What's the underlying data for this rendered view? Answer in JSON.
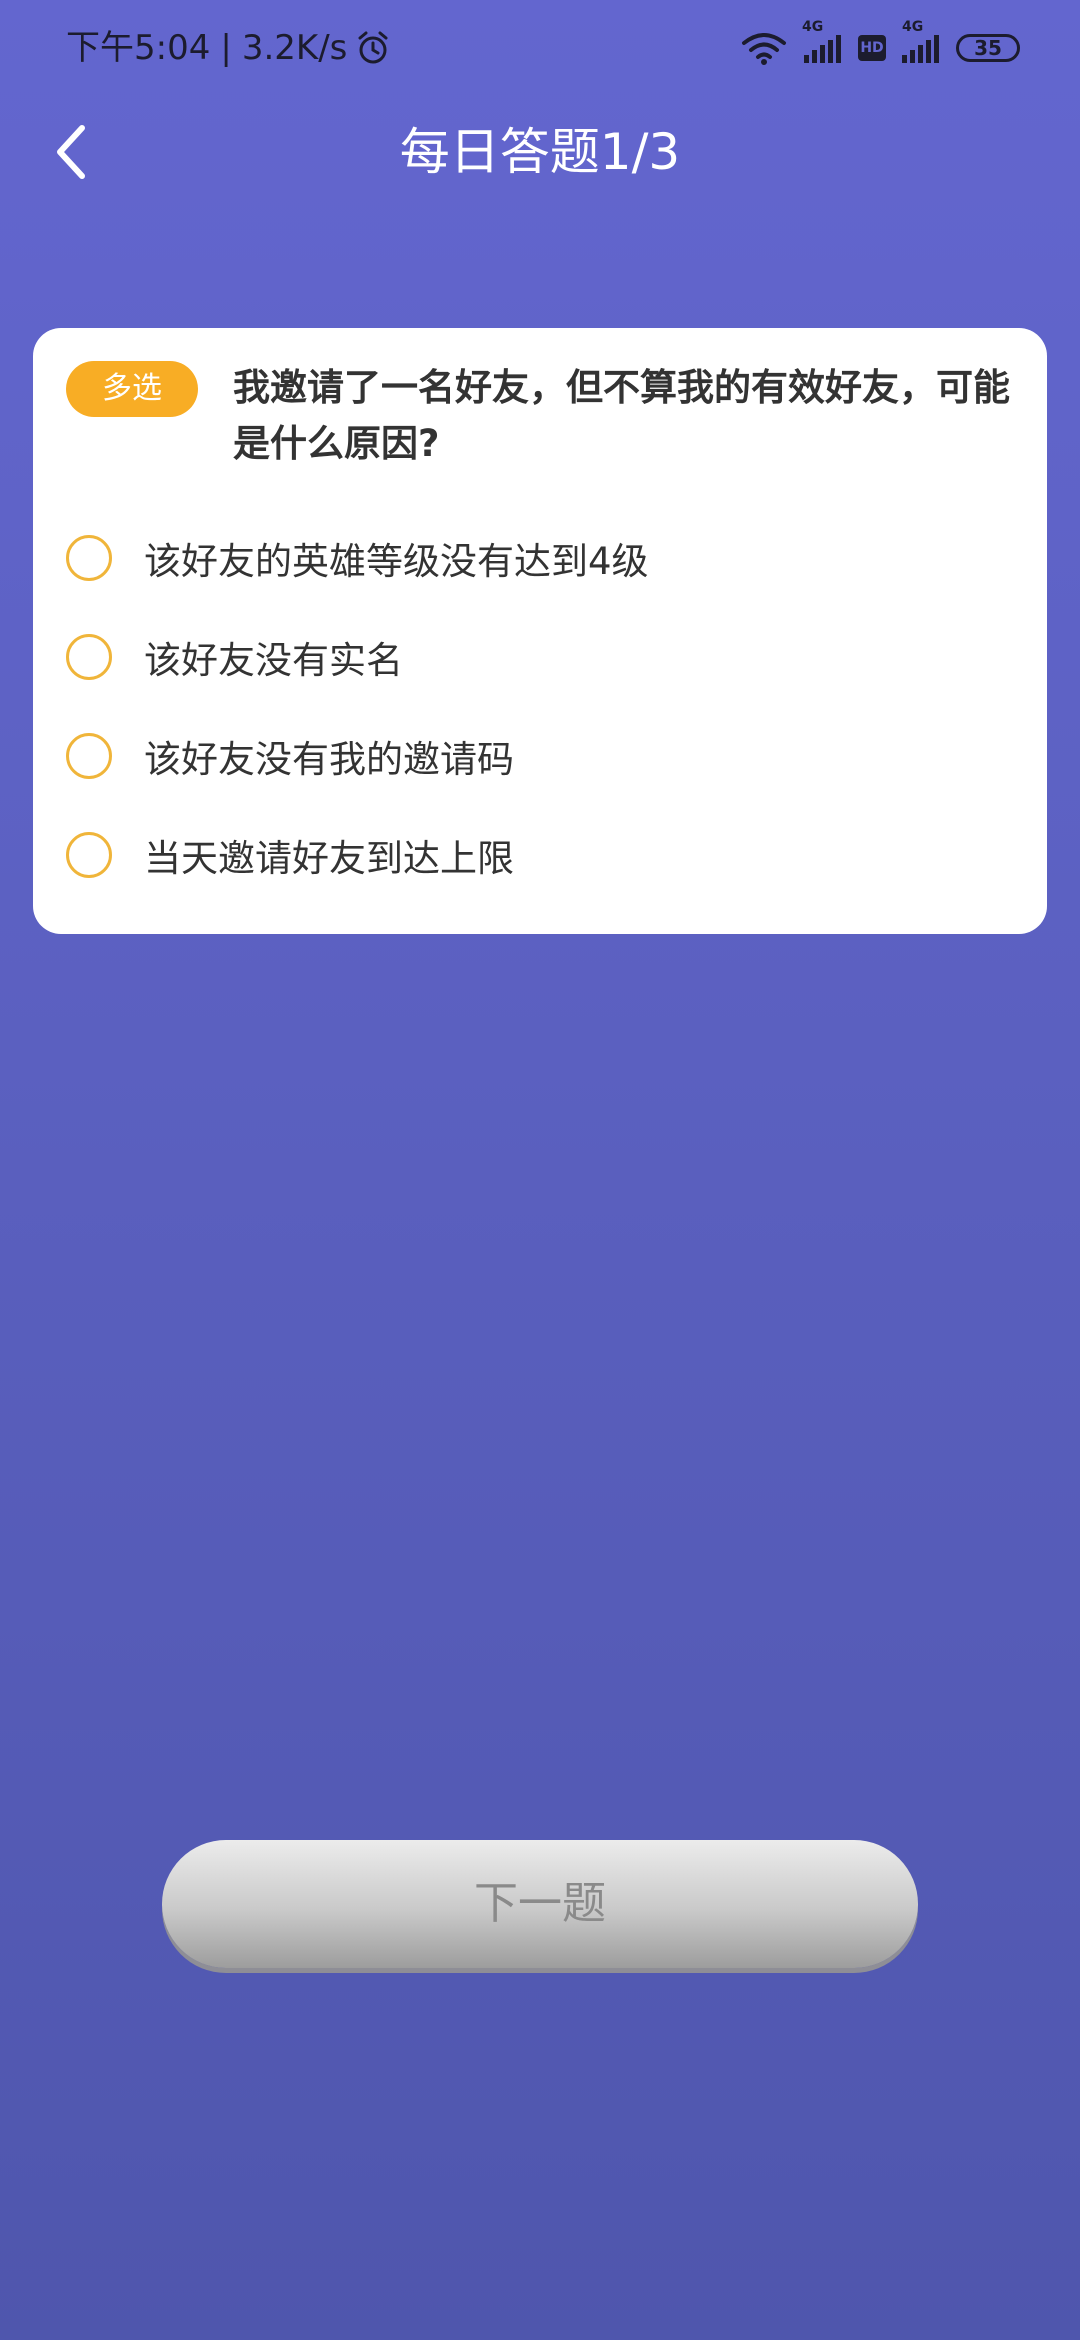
{
  "status_bar": {
    "time": "下午5:04",
    "separator": "|",
    "speed": "3.2K/s",
    "sim1_label": "4G",
    "hd_label": "HD",
    "sim2_label": "4G",
    "battery": "35"
  },
  "header": {
    "title": "每日答题1/3"
  },
  "question": {
    "type_badge": "多选",
    "text": "我邀请了一名好友，但不算我的有效好友，可能是什么原因?",
    "options": [
      {
        "label": "该好友的英雄等级没有达到4级"
      },
      {
        "label": "该好友没有实名"
      },
      {
        "label": "该好友没有我的邀请码"
      },
      {
        "label": "当天邀请好友到达上限"
      }
    ]
  },
  "footer": {
    "next_label": "下一题"
  },
  "colors": {
    "accent": "#f8ad25",
    "radio_border": "#f0b53a",
    "background_top": "#6366cf",
    "background_bottom": "#4f56ad"
  }
}
